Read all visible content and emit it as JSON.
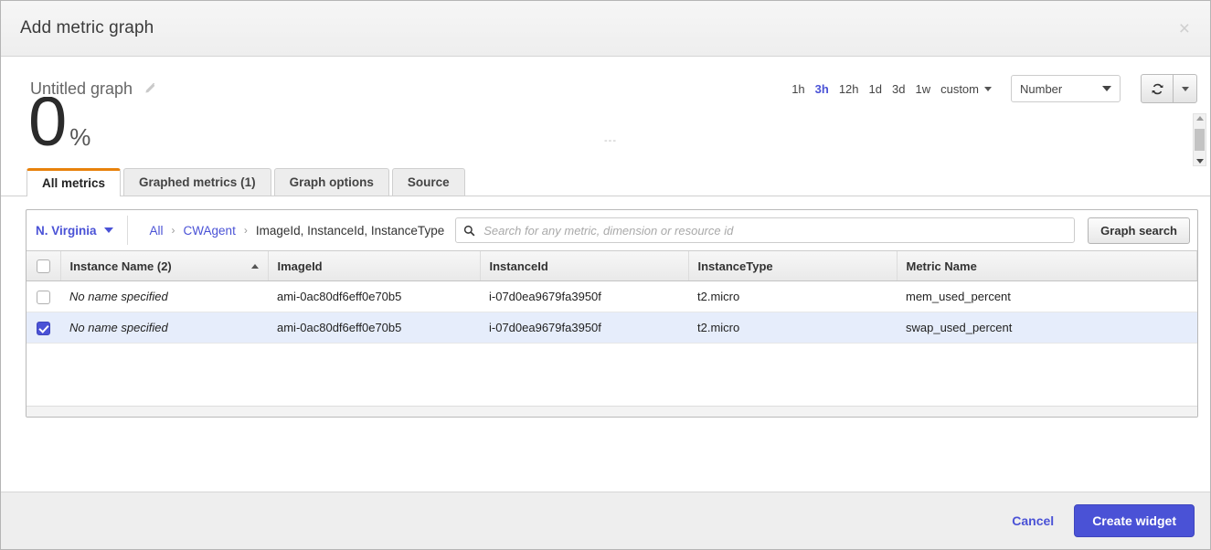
{
  "modal": {
    "title": "Add metric graph",
    "close_label": "×"
  },
  "graph": {
    "name": "Untitled graph",
    "edit_icon": "pencil-icon",
    "preview_value": "0",
    "preview_unit": "%",
    "preview_dashes": "---"
  },
  "time_ranges": [
    {
      "label": "1h",
      "active": false
    },
    {
      "label": "3h",
      "active": true
    },
    {
      "label": "12h",
      "active": false
    },
    {
      "label": "1d",
      "active": false
    },
    {
      "label": "3d",
      "active": false
    },
    {
      "label": "1w",
      "active": false
    }
  ],
  "custom_range": {
    "label": "custom"
  },
  "widget_type": {
    "value": "Number"
  },
  "refresh": {
    "icon": "refresh-icon"
  },
  "tabs": [
    {
      "label": "All metrics",
      "active": true
    },
    {
      "label": "Graphed metrics (1)",
      "active": false
    },
    {
      "label": "Graph options",
      "active": false
    },
    {
      "label": "Source",
      "active": false
    }
  ],
  "toolbar": {
    "region": "N. Virginia",
    "breadcrumb": [
      {
        "label": "All",
        "link": true
      },
      {
        "label": "CWAgent",
        "link": true
      },
      {
        "label": "ImageId, InstanceId, InstanceType",
        "link": false
      }
    ],
    "search_placeholder": "Search for any metric, dimension or resource id",
    "search_value": "",
    "graph_search_label": "Graph search"
  },
  "table": {
    "columns": [
      {
        "label": "Instance Name  (2)",
        "sorted": true
      },
      {
        "label": "ImageId",
        "sorted": false
      },
      {
        "label": "InstanceId",
        "sorted": false
      },
      {
        "label": "InstanceType",
        "sorted": false
      },
      {
        "label": "Metric Name",
        "sorted": false
      }
    ],
    "select_all_checked": false,
    "rows": [
      {
        "selected": false,
        "instance_name": "No name specified",
        "image_id": "ami-0ac80df6eff0e70b5",
        "instance_id": "i-07d0ea9679fa3950f",
        "instance_type": "t2.micro",
        "metric_name": "mem_used_percent"
      },
      {
        "selected": true,
        "instance_name": "No name specified",
        "image_id": "ami-0ac80df6eff0e70b5",
        "instance_id": "i-07d0ea9679fa3950f",
        "instance_type": "t2.micro",
        "metric_name": "swap_used_percent"
      }
    ]
  },
  "footer": {
    "cancel_label": "Cancel",
    "create_label": "Create widget"
  },
  "colors": {
    "accent_blue": "#4a52d6",
    "tab_active_orange": "#e8820c",
    "row_selected_bg": "#e6edfb"
  }
}
